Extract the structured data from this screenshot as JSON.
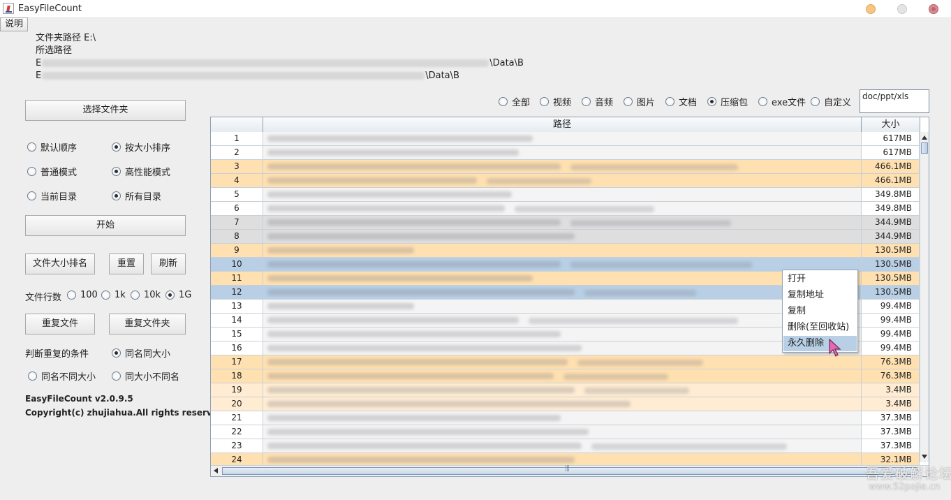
{
  "window": {
    "title": "EasyFileCount"
  },
  "menu": {
    "help_label": "说明"
  },
  "info": {
    "folder_path_line": "文件夹路径 E:\\",
    "selected_path_label": "所选路径",
    "path1_prefix": "E",
    "path1_suffix": "\\Data\\B",
    "path2_prefix": "E",
    "path2_suffix": "\\Data\\B"
  },
  "left": {
    "select_folder_label": "选择文件夹",
    "order_options": [
      "默认顺序",
      "按大小排序"
    ],
    "mode_options": [
      "普通模式",
      "高性能模式"
    ],
    "scope_options": [
      "当前目录",
      "所有目录"
    ],
    "start_label": "开始",
    "rank_label": "文件大小排名",
    "reset_label": "重置",
    "refresh_label": "刷新",
    "rows_label": "文件行数",
    "rows_options": [
      "100",
      "1k",
      "10k",
      "1G"
    ],
    "dup_file_label": "重复文件",
    "dup_folder_label": "重复文件夹",
    "dup_condition_label": "判断重复的条件",
    "dup_options": [
      "同名同大小",
      "同名不同大小",
      "同大小不同名"
    ],
    "version": "EasyFileCount v2.0.9.5",
    "copyright": "Copyright(c) zhujiahua.All rights reserved."
  },
  "filters": {
    "options": [
      "全部",
      "视频",
      "音频",
      "图片",
      "文档",
      "压缩包",
      "exe文件",
      "自定义"
    ],
    "selected": "压缩包",
    "custom_value": "doc/ppt/xls"
  },
  "table": {
    "headers": {
      "index": "",
      "path": "路径",
      "size": "大小"
    },
    "rows": [
      {
        "num": "1",
        "size": "617MB"
      },
      {
        "num": "2",
        "size": "617MB"
      },
      {
        "num": "3",
        "size": "466.1MB"
      },
      {
        "num": "4",
        "size": "466.1MB"
      },
      {
        "num": "5",
        "size": "349.8MB"
      },
      {
        "num": "6",
        "size": "349.8MB"
      },
      {
        "num": "7",
        "size": "344.9MB"
      },
      {
        "num": "8",
        "size": "344.9MB"
      },
      {
        "num": "9",
        "size": "130.5MB"
      },
      {
        "num": "10",
        "size": "130.5MB"
      },
      {
        "num": "11",
        "size": "130.5MB"
      },
      {
        "num": "12",
        "size": "130.5MB"
      },
      {
        "num": "13",
        "size": "99.4MB"
      },
      {
        "num": "14",
        "size": "99.4MB"
      },
      {
        "num": "15",
        "size": "99.4MB"
      },
      {
        "num": "16",
        "size": "99.4MB"
      },
      {
        "num": "17",
        "size": "76.3MB"
      },
      {
        "num": "18",
        "size": "76.3MB"
      },
      {
        "num": "19",
        "size": "3.4MB"
      },
      {
        "num": "20",
        "size": "3.4MB"
      },
      {
        "num": "21",
        "size": "37.3MB"
      },
      {
        "num": "22",
        "size": "37.3MB"
      },
      {
        "num": "23",
        "size": "37.3MB"
      },
      {
        "num": "24",
        "size": "32.1MB"
      }
    ]
  },
  "context_menu": {
    "items": [
      "打开",
      "复制地址",
      "复制",
      "删除(至回收站)",
      "永久删除"
    ],
    "highlighted": "永久删除"
  },
  "watermark": {
    "text": "吾爱破解论坛",
    "url": "www.52pojie.cn"
  },
  "colors": {
    "row_orange": "#ffe0b0",
    "row_light_orange": "#ffecd2",
    "row_gray": "#dedede",
    "row_selected": "#b8cfe5",
    "row_white": "#f4f4f4"
  }
}
